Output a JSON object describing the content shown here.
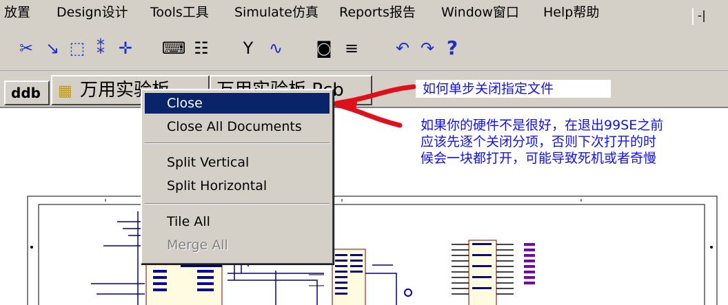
{
  "menubar": {
    "items": [
      {
        "label": "放置"
      },
      {
        "label": "Design设计"
      },
      {
        "label": "Tools工具"
      },
      {
        "label": "Simulate仿真"
      },
      {
        "label": "Reports报告"
      },
      {
        "label": "Window窗口"
      },
      {
        "label": "Help帮助"
      }
    ],
    "window_buttons": "-|"
  },
  "toolbar": {
    "icons": [
      {
        "name": "wire-icon",
        "glyph": "✂"
      },
      {
        "name": "select-arrow-icon",
        "glyph": "↘"
      },
      {
        "name": "select-rect-icon",
        "glyph": "⬚"
      },
      {
        "name": "deselect-icon",
        "glyph": "⁑"
      },
      {
        "name": "move-cross-icon",
        "glyph": "✛"
      },
      {
        "name": "library-browser-icon",
        "glyph": "⌨"
      },
      {
        "name": "netlist-icon",
        "glyph": "☷"
      },
      {
        "name": "probe-icon",
        "glyph": "Y"
      },
      {
        "name": "waveform-icon",
        "glyph": "∿"
      },
      {
        "name": "component-icon",
        "glyph": "◙"
      },
      {
        "name": "pin-list-icon",
        "glyph": "≡"
      },
      {
        "name": "undo-icon",
        "glyph": "↶"
      },
      {
        "name": "redo-icon",
        "glyph": "↷"
      },
      {
        "name": "help-icon",
        "glyph": "?"
      }
    ]
  },
  "tabs": [
    {
      "label": "ddb"
    },
    {
      "label": "万用实验板"
    },
    {
      "label": "万用实验板.Pcb"
    }
  ],
  "annotations": {
    "title": "如何单步关闭指定文件",
    "lines": [
      "如果你的硬件不是很好，在退出99SE之前",
      "应该先逐个关闭分项，否则下次打开的时",
      "候会一块都打开，可能导致死机或者奇慢"
    ],
    "colors": {
      "text": "#1010ee",
      "arrow": "#e0101a"
    }
  },
  "context_menu": {
    "items": [
      {
        "label": "Close",
        "selected": true
      },
      {
        "label": "Close All Documents"
      },
      {
        "label": "Split Vertical"
      },
      {
        "label": "Split Horizontal"
      },
      {
        "label": "Tile All"
      },
      {
        "label": "Merge All",
        "disabled": true
      }
    ]
  }
}
